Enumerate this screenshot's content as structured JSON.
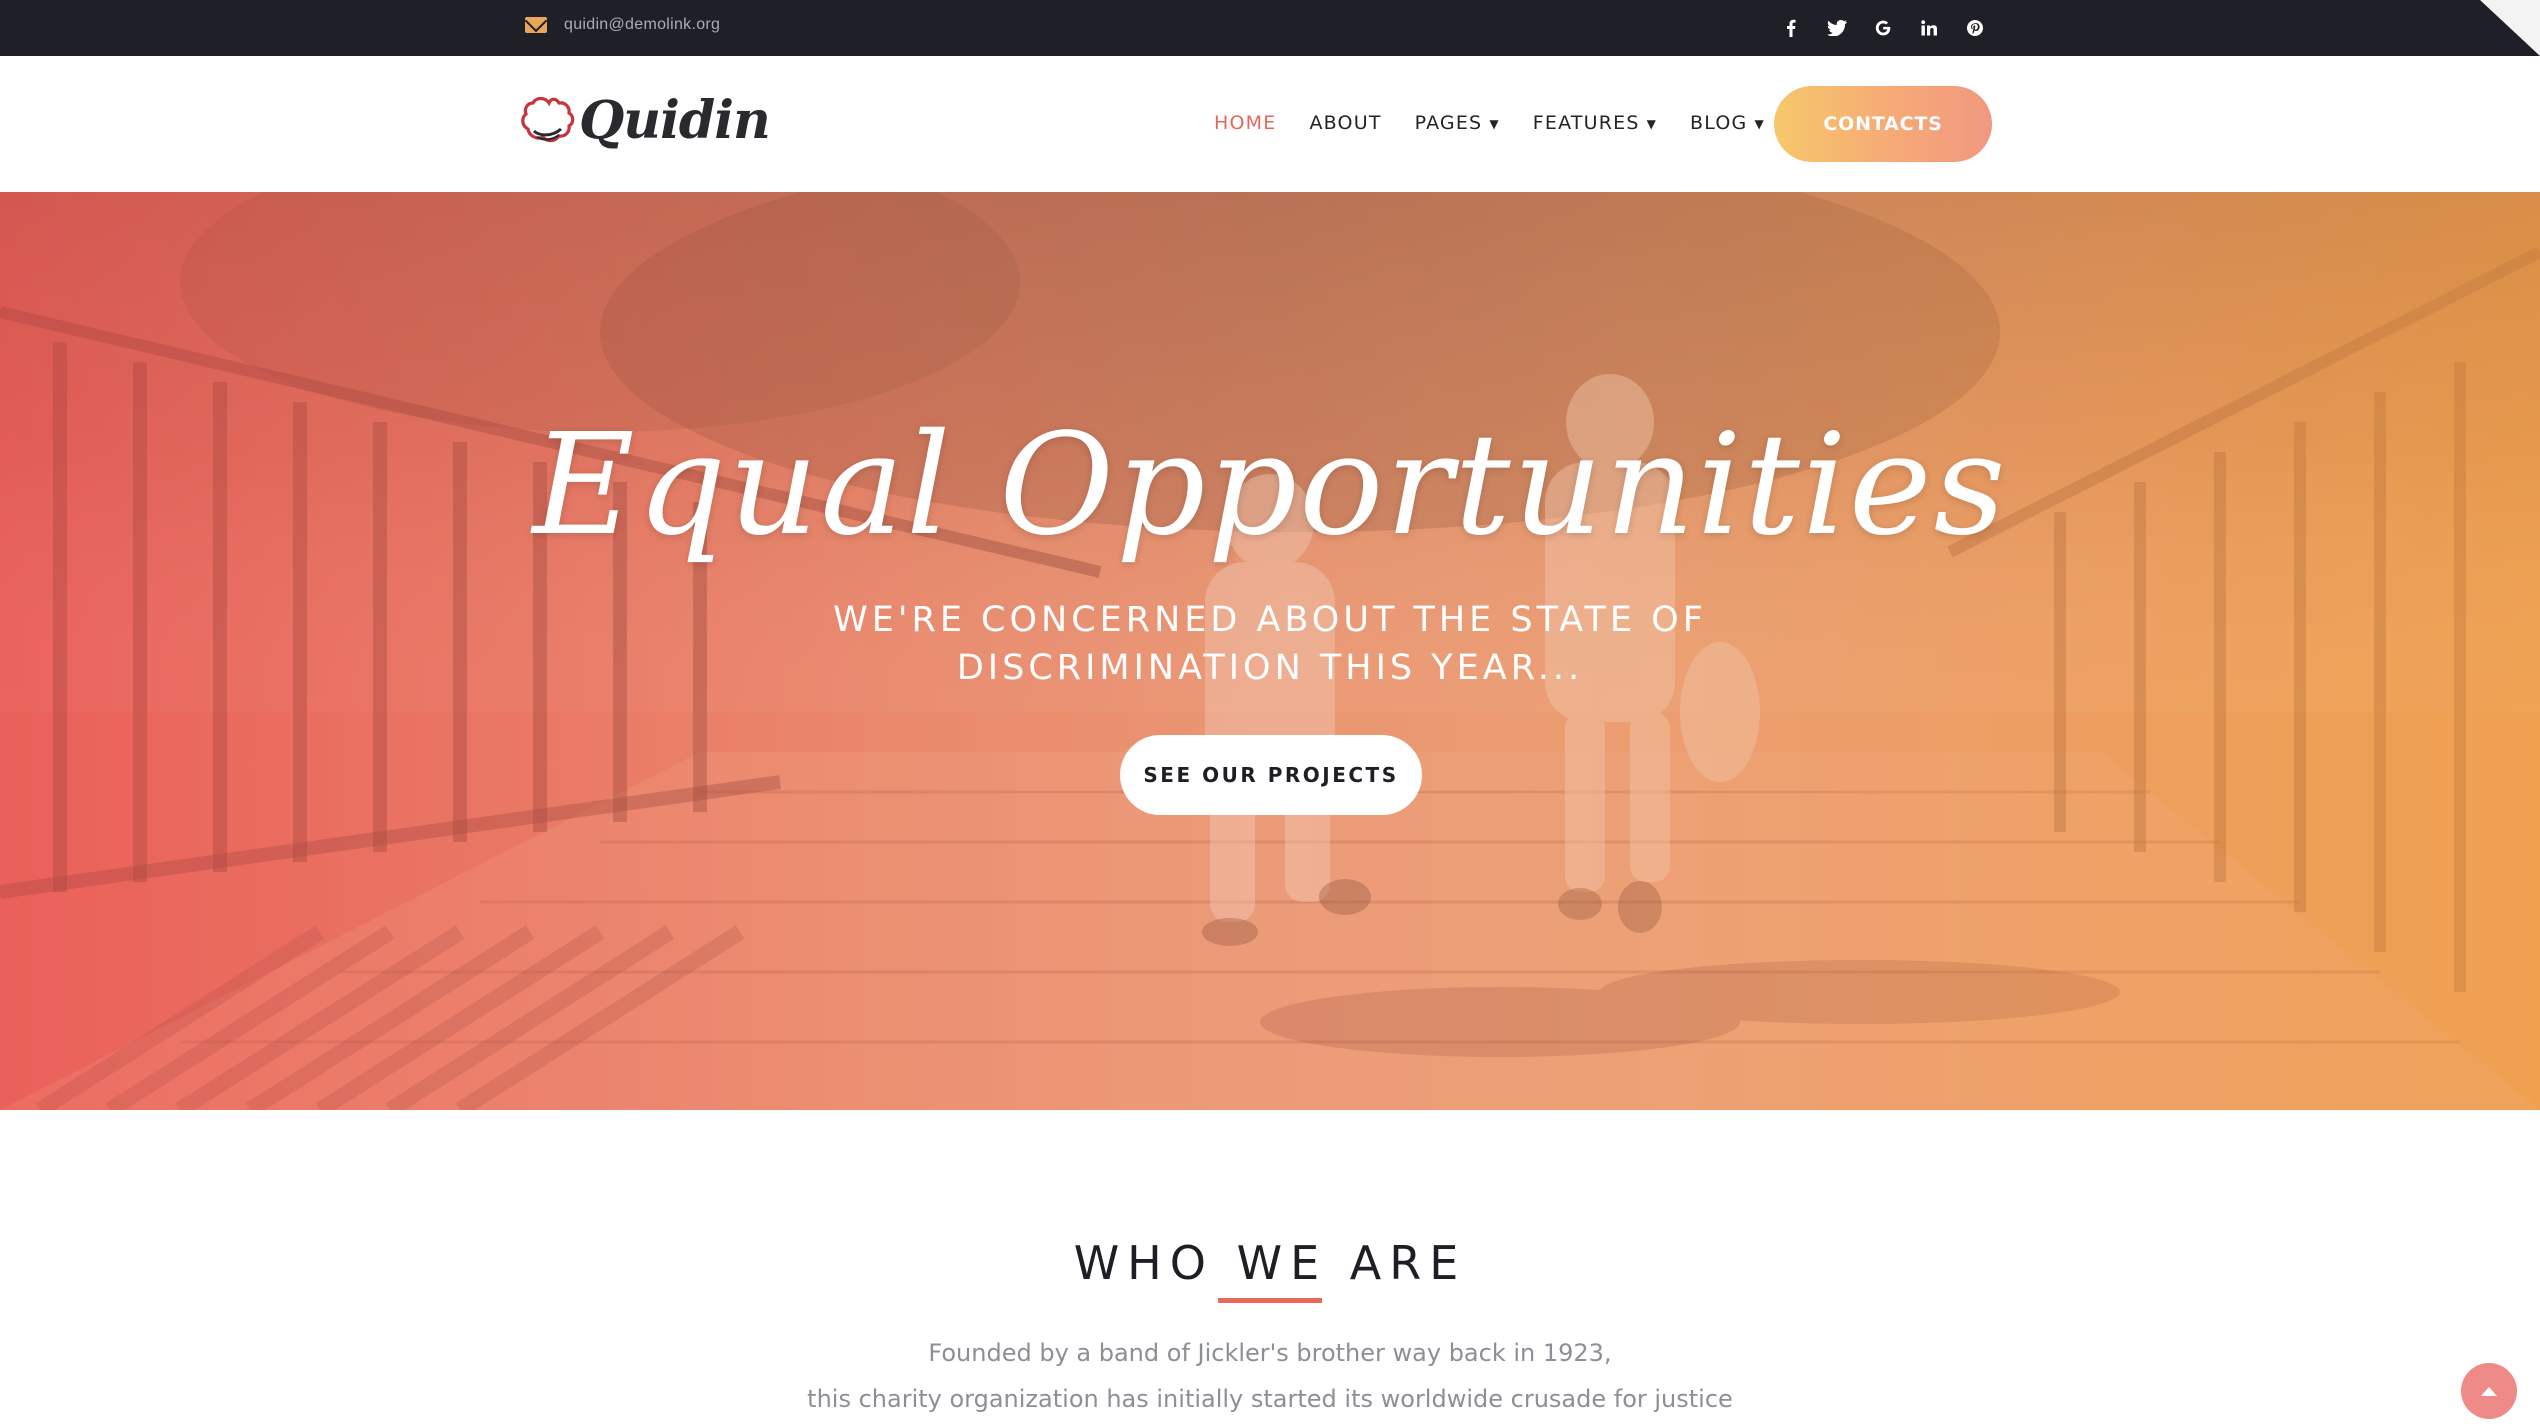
{
  "topbar": {
    "email": "quidin@demolink.org",
    "socials": [
      "facebook-icon",
      "twitter-icon",
      "google-icon",
      "linkedin-icon",
      "pinterest-icon"
    ]
  },
  "header": {
    "logo_text": "Quidin",
    "nav": [
      {
        "label": "HOME",
        "active": true,
        "dropdown": false
      },
      {
        "label": "ABOUT",
        "active": false,
        "dropdown": false
      },
      {
        "label": "PAGES",
        "active": false,
        "dropdown": true
      },
      {
        "label": "FEATURES",
        "active": false,
        "dropdown": true
      },
      {
        "label": "BLOG",
        "active": false,
        "dropdown": true
      }
    ],
    "contacts_label": "CONTACTS"
  },
  "hero": {
    "title": "Equal Opportunities",
    "subtitle_line1": "WE'RE CONCERNED ABOUT THE STATE OF",
    "subtitle_line2": "DISCRIMINATION THIS YEAR...",
    "button_label": "SEE OUR PROJECTS"
  },
  "who": {
    "title": "WHO WE ARE",
    "line1": "Founded by a band of Jickler's brother way back in 1923,",
    "line2": "this charity organization has initially started its worldwide crusade for justice"
  },
  "colors": {
    "accent": "#e8675b",
    "topbar": "#1f2027",
    "gradient_start": "#e8615a",
    "gradient_end": "#efa052"
  }
}
